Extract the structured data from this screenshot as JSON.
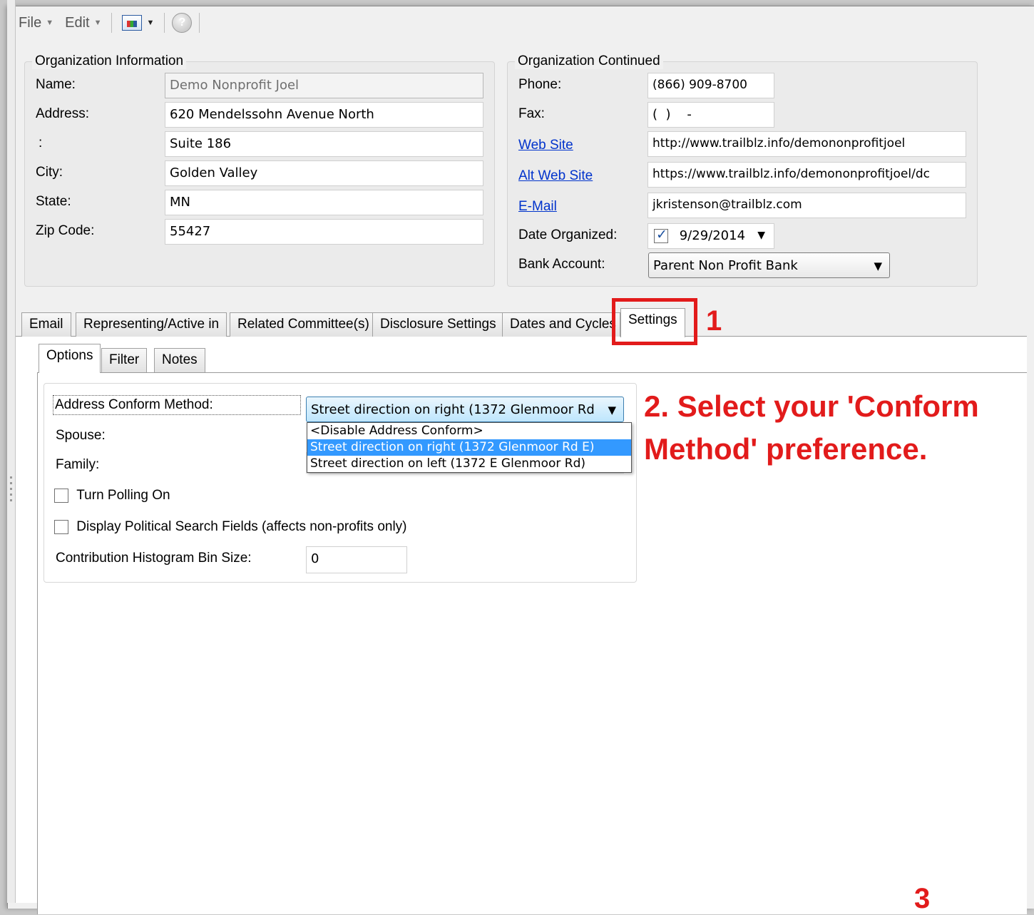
{
  "toolbar": {
    "file": "File",
    "edit": "Edit"
  },
  "org_info": {
    "title": "Organization Information",
    "name_label": "Name:",
    "name": "Demo Nonprofit Joel",
    "address_label": "Address:",
    "address1": "620 Mendelssohn Avenue North",
    "address2_label": ":",
    "address2": "Suite 186",
    "city_label": "City:",
    "city": "Golden Valley",
    "state_label": "State:",
    "state": "MN",
    "zip_label": "Zip Code:",
    "zip": "55427"
  },
  "org_continued": {
    "title": "Organization Continued",
    "phone_label": "Phone:",
    "phone": "(866) 909-8700",
    "fax_label": "Fax:",
    "fax": "(  )    -",
    "website_label": "Web Site",
    "website": "http://www.trailblz.info/demononprofitjoel",
    "alt_website_label": "Alt Web Site",
    "alt_website": "https://www.trailblz.info/demononprofitjoel/dc",
    "email_label": "E-Mail",
    "email": "jkristenson@trailblz.com",
    "date_organized_label": "Date Organized:",
    "date_organized": "9/29/2014",
    "bank_account_label": "Bank Account:",
    "bank_account": "Parent Non Profit Bank"
  },
  "tabs": [
    {
      "label": "Email"
    },
    {
      "label": "Representing/Active in"
    },
    {
      "label": "Related Committee(s)"
    },
    {
      "label": "Disclosure Settings"
    },
    {
      "label": "Dates and Cycles"
    },
    {
      "label": "Settings"
    }
  ],
  "subtabs": [
    {
      "label": "Options"
    },
    {
      "label": "Filter"
    },
    {
      "label": "Notes"
    }
  ],
  "options": {
    "address_conform_label": "Address Conform Method:",
    "address_conform_value": "Street direction on right (1372 Glenmoor Rd",
    "conform_options": [
      "<Disable Address Conform>",
      "Street direction on right (1372 Glenmoor Rd E)",
      "Street direction on left (1372 E Glenmoor Rd)"
    ],
    "spouse_label": "Spouse:",
    "family_label": "Family:",
    "polling_label": "Turn Polling On",
    "political_label": "Display Political Search Fields (affects non-profits only)",
    "histogram_label": "Contribution Histogram Bin Size:",
    "histogram_value": "0"
  },
  "annotations": {
    "step1": "1",
    "step2": "2. Select your 'Conform Method' preference.",
    "step3": "3"
  },
  "colors": {
    "annotation": "#e21b1b",
    "selection": "#3399ff",
    "link": "#0033cc"
  }
}
